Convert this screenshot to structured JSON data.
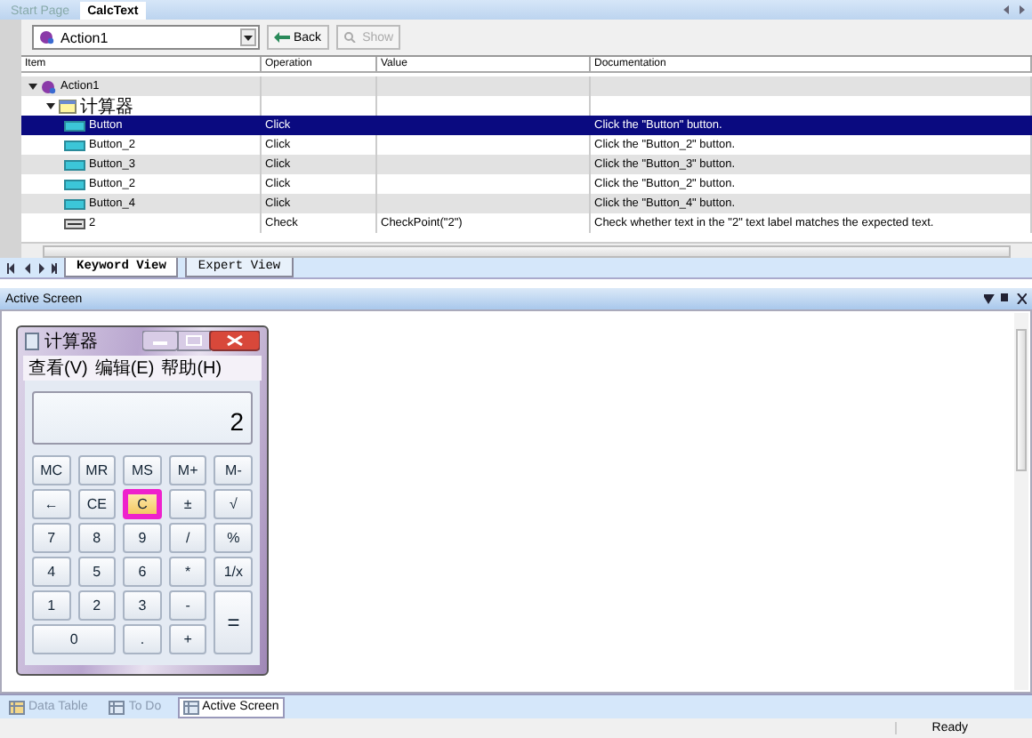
{
  "doc_tabs": [
    {
      "label": "Start Page",
      "selected": false
    },
    {
      "label": "CalcText",
      "selected": true
    }
  ],
  "toolbar": {
    "action_select": "Action1",
    "buttons": [
      {
        "label": "Back",
        "disabled": false
      },
      {
        "label": "Show",
        "disabled": true
      }
    ]
  },
  "grid": {
    "columns": [
      "Item",
      "Operation",
      "Value",
      "Documentation"
    ],
    "rows": [
      {
        "item": "Action1",
        "kind": "action",
        "selected": false,
        "expanded": true,
        "children": [
          {
            "item": "计算器",
            "kind": "window",
            "selected": false,
            "expanded": true,
            "children": [
              {
                "item": "Button",
                "kind": "button",
                "operation": "Click",
                "documentation": "Click the \"Button\" button.",
                "selected": true
              },
              {
                "item": "Button_2",
                "kind": "button",
                "operation": "Click",
                "documentation": "Click the \"Button_2\" button.",
                "selected": false
              },
              {
                "item": "Button_3",
                "kind": "button",
                "operation": "Click",
                "documentation": "Click the \"Button_3\" button.",
                "selected": false
              },
              {
                "item": "Button_2",
                "kind": "button",
                "operation": "Click",
                "documentation": "Click the \"Button_2\" button.",
                "selected": false
              },
              {
                "item": "Button_4",
                "kind": "button",
                "operation": "Click",
                "documentation": "Click the \"Button_4\" button.",
                "selected": false
              },
              {
                "item": "2",
                "kind": "label",
                "operation": "Check",
                "value": "CheckPoint(\"2\")",
                "documentation": "Check whether text in the \"2\" text label matches the expected text.",
                "selected": false
              }
            ]
          }
        ]
      }
    ]
  },
  "view_tabs": [
    {
      "label": "Keyword View",
      "selected": true
    },
    {
      "label": "Expert View",
      "selected": false
    }
  ],
  "panel": {
    "title": "Active Screen"
  },
  "calculator": {
    "title": "计算器",
    "menu": [
      "查看(V)",
      "编辑(E)",
      "帮助(H)"
    ],
    "display": "2",
    "keys": [
      {
        "label": "MC",
        "kind": "normal",
        "highlighted": false
      },
      {
        "label": "MR",
        "kind": "normal",
        "highlighted": false
      },
      {
        "label": "MS",
        "kind": "normal",
        "highlighted": false
      },
      {
        "label": "M+",
        "kind": "normal",
        "highlighted": false
      },
      {
        "label": "M-",
        "kind": "normal",
        "highlighted": false
      },
      {
        "label": "←",
        "kind": "normal",
        "highlighted": false
      },
      {
        "label": "CE",
        "kind": "normal",
        "highlighted": false
      },
      {
        "label": "C",
        "kind": "normal",
        "highlighted": true
      },
      {
        "label": "±",
        "kind": "normal",
        "highlighted": false
      },
      {
        "label": "√",
        "kind": "normal",
        "highlighted": false
      },
      {
        "label": "7",
        "kind": "normal",
        "highlighted": false
      },
      {
        "label": "8",
        "kind": "normal",
        "highlighted": false
      },
      {
        "label": "9",
        "kind": "normal",
        "highlighted": false
      },
      {
        "label": "/",
        "kind": "normal",
        "highlighted": false
      },
      {
        "label": "%",
        "kind": "normal",
        "highlighted": false
      },
      {
        "label": "4",
        "kind": "normal",
        "highlighted": false
      },
      {
        "label": "5",
        "kind": "normal",
        "highlighted": false
      },
      {
        "label": "6",
        "kind": "normal",
        "highlighted": false
      },
      {
        "label": "*",
        "kind": "normal",
        "highlighted": false
      },
      {
        "label": "1/x",
        "kind": "normal",
        "highlighted": false
      },
      {
        "label": "1",
        "kind": "normal",
        "highlighted": false
      },
      {
        "label": "2",
        "kind": "normal",
        "highlighted": false
      },
      {
        "label": "3",
        "kind": "normal",
        "highlighted": false
      },
      {
        "label": "-",
        "kind": "normal",
        "highlighted": false
      },
      {
        "label": "=",
        "kind": "tall",
        "highlighted": false
      },
      {
        "label": "0",
        "kind": "wide",
        "highlighted": false
      },
      {
        "label": ".",
        "kind": "normal",
        "highlighted": false
      },
      {
        "label": "+",
        "kind": "normal",
        "highlighted": false
      }
    ]
  },
  "bottom_tabs": [
    {
      "label": "Data Table",
      "selected": false
    },
    {
      "label": "To Do",
      "selected": false
    },
    {
      "label": "Active Screen",
      "selected": true
    }
  ],
  "status_bar": {
    "text": "Ready"
  }
}
